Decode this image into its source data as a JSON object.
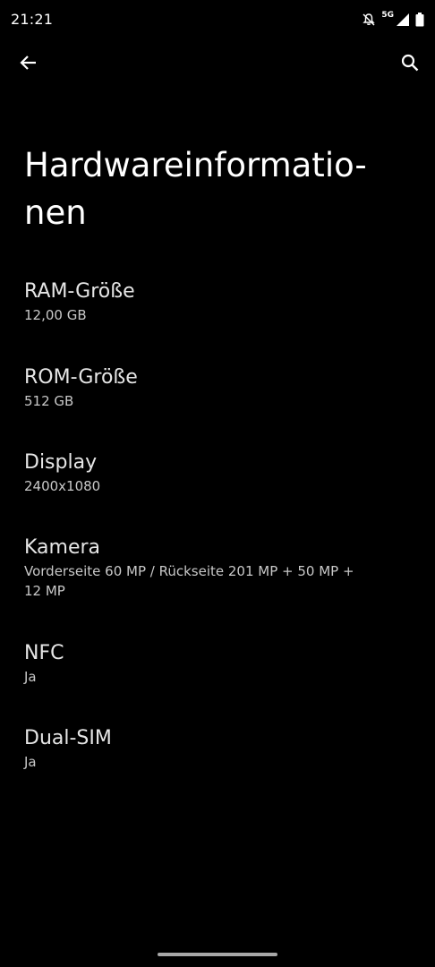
{
  "status_bar": {
    "time": "21:21",
    "network": "5G",
    "icons": [
      "notifications-off-icon",
      "cell-signal-icon",
      "battery-icon"
    ]
  },
  "toolbar": {
    "back_icon": "arrow-back-icon",
    "search_icon": "search-icon"
  },
  "page": {
    "title": "Hardwareinformatio-\nnen"
  },
  "items": [
    {
      "title": "RAM-Größe",
      "value": "12,00 GB"
    },
    {
      "title": "ROM-Größe",
      "value": "512 GB"
    },
    {
      "title": "Display",
      "value": "2400x1080"
    },
    {
      "title": "Kamera",
      "value": "Vorderseite 60 MP / Rückseite 201 MP + 50 MP +\n12 MP"
    },
    {
      "title": "NFC",
      "value": "Ja"
    },
    {
      "title": "Dual-SIM",
      "value": "Ja"
    }
  ],
  "colors": {
    "background": "#000000",
    "title_text": "#ffffff",
    "item_title": "#e6e6e6",
    "item_value": "#c8c8c8"
  }
}
